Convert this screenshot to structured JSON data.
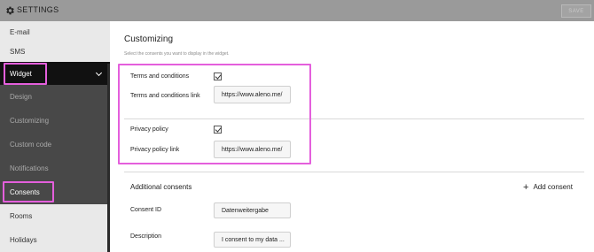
{
  "topbar": {
    "title": "SETTINGS",
    "save_label": "SAVE",
    "icon": "gear-icon"
  },
  "sidebar": {
    "items": [
      {
        "label": "E-mail"
      },
      {
        "label": "SMS"
      },
      {
        "label": "Widget"
      },
      {
        "label": "Design"
      },
      {
        "label": "Customizing"
      },
      {
        "label": "Custom code"
      },
      {
        "label": "Notifications"
      },
      {
        "label": "Consents"
      },
      {
        "label": "Rooms"
      },
      {
        "label": "Holidays"
      }
    ]
  },
  "main": {
    "title": "Customizing",
    "subtitle": "Select the consents you want to display in the widget.",
    "terms": {
      "label": "Terms and conditions",
      "checked": true,
      "link_label": "Terms and conditions link",
      "link_value": "https://www.aleno.me/"
    },
    "privacy": {
      "label": "Privacy policy",
      "checked": true,
      "link_label": "Privacy policy link",
      "link_value": "https://www.aleno.me/"
    },
    "additional": {
      "title": "Additional consents",
      "add_label": "Add consent",
      "consent_id_label": "Consent ID",
      "consent_id_value": "Datenweitergabe",
      "description_label": "Description",
      "description_value": "I consent to my data ..."
    }
  },
  "colors": {
    "highlight": "#e45fdc",
    "topbar": "#9a9a9a",
    "sidebar_dark": "#484848",
    "sidebar_active": "#111111"
  }
}
